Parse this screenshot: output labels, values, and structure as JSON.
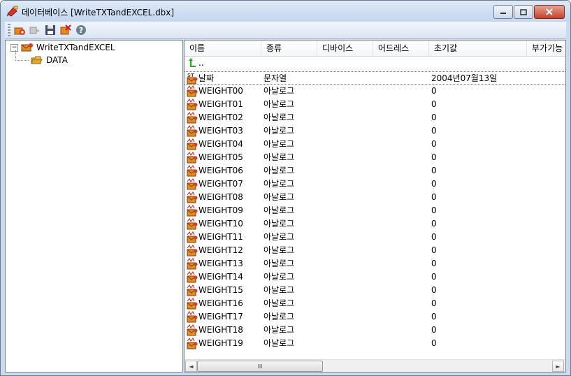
{
  "window": {
    "title": "데이터베이스 [WriteTXTandEXCEL.dbx]",
    "buttons": {
      "minimize_glyph": "—",
      "maximize_glyph": "□",
      "close_glyph": "✕"
    }
  },
  "toolbar": {
    "buttons": [
      "add-icon",
      "forward-icon",
      "save-icon",
      "delete-icon",
      "help-icon"
    ]
  },
  "tree": {
    "root": {
      "expander": "−",
      "label": "WriteTXTandEXCEL"
    },
    "child": {
      "label": "DATA"
    }
  },
  "list": {
    "columns": [
      "이름",
      "종류",
      "디바이스",
      "어드레스",
      "초기값",
      "부가기능"
    ],
    "up_row_label": "..",
    "rows": [
      {
        "name": "날짜",
        "type": "문자열",
        "device": "",
        "address": "",
        "initial": "2004년07월13일",
        "icon": "ST",
        "selected": true
      },
      {
        "name": "WEIGHT00",
        "type": "아날로그",
        "device": "",
        "address": "",
        "initial": "0",
        "icon": "AN"
      },
      {
        "name": "WEIGHT01",
        "type": "아날로그",
        "device": "",
        "address": "",
        "initial": "0",
        "icon": "AN"
      },
      {
        "name": "WEIGHT02",
        "type": "아날로그",
        "device": "",
        "address": "",
        "initial": "0",
        "icon": "AN"
      },
      {
        "name": "WEIGHT03",
        "type": "아날로그",
        "device": "",
        "address": "",
        "initial": "0",
        "icon": "AN"
      },
      {
        "name": "WEIGHT04",
        "type": "아날로그",
        "device": "",
        "address": "",
        "initial": "0",
        "icon": "AN"
      },
      {
        "name": "WEIGHT05",
        "type": "아날로그",
        "device": "",
        "address": "",
        "initial": "0",
        "icon": "AN"
      },
      {
        "name": "WEIGHT06",
        "type": "아날로그",
        "device": "",
        "address": "",
        "initial": "0",
        "icon": "AN"
      },
      {
        "name": "WEIGHT07",
        "type": "아날로그",
        "device": "",
        "address": "",
        "initial": "0",
        "icon": "AN"
      },
      {
        "name": "WEIGHT08",
        "type": "아날로그",
        "device": "",
        "address": "",
        "initial": "0",
        "icon": "AN"
      },
      {
        "name": "WEIGHT09",
        "type": "아날로그",
        "device": "",
        "address": "",
        "initial": "0",
        "icon": "AN"
      },
      {
        "name": "WEIGHT10",
        "type": "아날로그",
        "device": "",
        "address": "",
        "initial": "0",
        "icon": "AN"
      },
      {
        "name": "WEIGHT11",
        "type": "아날로그",
        "device": "",
        "address": "",
        "initial": "0",
        "icon": "AN"
      },
      {
        "name": "WEIGHT12",
        "type": "아날로그",
        "device": "",
        "address": "",
        "initial": "0",
        "icon": "AN"
      },
      {
        "name": "WEIGHT13",
        "type": "아날로그",
        "device": "",
        "address": "",
        "initial": "0",
        "icon": "AN"
      },
      {
        "name": "WEIGHT14",
        "type": "아날로그",
        "device": "",
        "address": "",
        "initial": "0",
        "icon": "AN"
      },
      {
        "name": "WEIGHT15",
        "type": "아날로그",
        "device": "",
        "address": "",
        "initial": "0",
        "icon": "AN"
      },
      {
        "name": "WEIGHT16",
        "type": "아날로그",
        "device": "",
        "address": "",
        "initial": "0",
        "icon": "AN"
      },
      {
        "name": "WEIGHT17",
        "type": "아날로그",
        "device": "",
        "address": "",
        "initial": "0",
        "icon": "AN"
      },
      {
        "name": "WEIGHT18",
        "type": "아날로그",
        "device": "",
        "address": "",
        "initial": "0",
        "icon": "AN"
      },
      {
        "name": "WEIGHT19",
        "type": "아날로그",
        "device": "",
        "address": "",
        "initial": "0",
        "icon": "AN"
      }
    ]
  },
  "scrollbar": {
    "left_arrow": "◄",
    "right_arrow": "►",
    "thumb_grip": "III"
  },
  "colors": {
    "titlebar": "#c9dbf0",
    "close_button": "#c5402a",
    "up_arrow": "#2da32d",
    "tag_icon": "#e58a1f"
  }
}
